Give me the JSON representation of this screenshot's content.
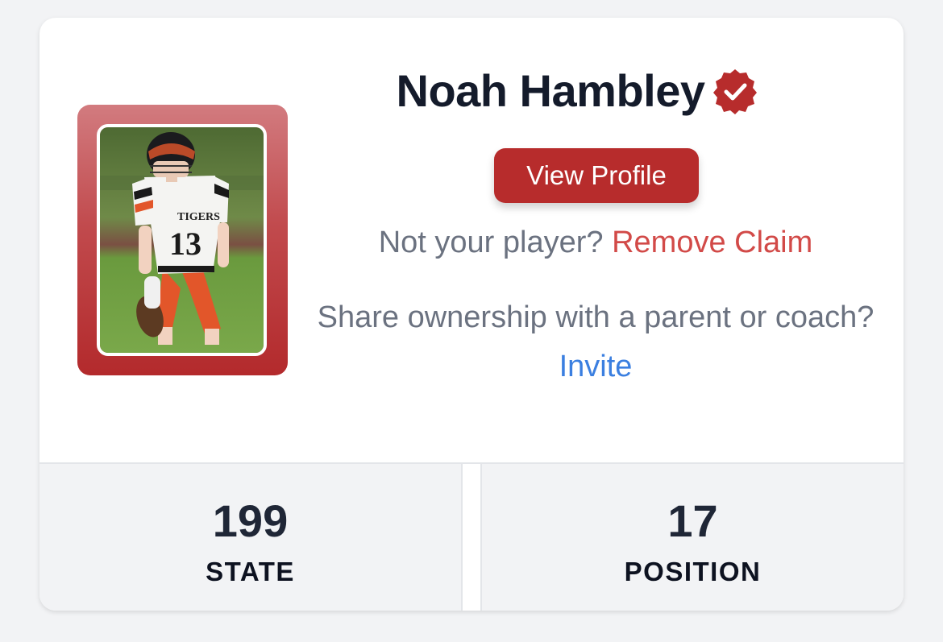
{
  "player": {
    "name": "Noah Hambley",
    "verified_icon": "verified-check-icon",
    "photo_icon": "football-player-photo",
    "jersey_number": "13",
    "jersey_team": "TIGERS"
  },
  "actions": {
    "view_profile_label": "View Profile",
    "not_your_player_text": "Not your player?",
    "remove_claim_label": "Remove Claim",
    "share_text": "Share ownership with a parent or coach?",
    "invite_label": "Invite"
  },
  "stats": [
    {
      "value": "199",
      "label": "STATE"
    },
    {
      "value": "17",
      "label": "POSITION"
    }
  ],
  "colors": {
    "accent": "#b72c2c",
    "remove_link": "#d24a48",
    "invite_link": "#3b7fe0",
    "muted_text": "#6b7280",
    "name_text": "#141b2b"
  }
}
